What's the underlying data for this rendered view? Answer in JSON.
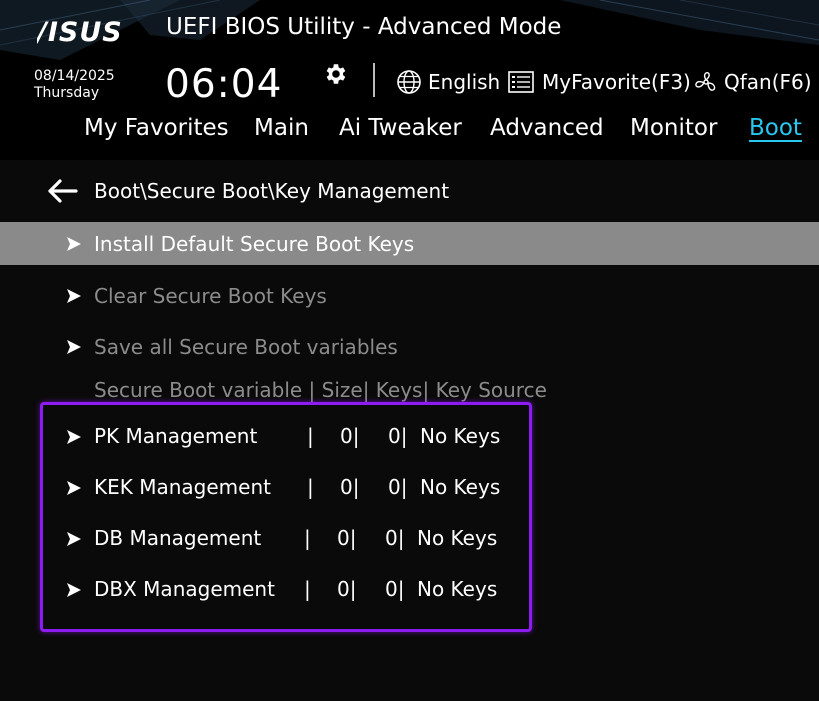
{
  "header": {
    "logo_text": "/ISUS",
    "title": "UEFI BIOS Utility - Advanced Mode",
    "date": "08/14/2025",
    "day": "Thursday",
    "time": "06:04",
    "tools": {
      "language": "English",
      "myfavorite": "MyFavorite(F3)",
      "qfan": "Qfan(F6)"
    }
  },
  "tabs": [
    {
      "label": "My Favorites",
      "active": false
    },
    {
      "label": "Main",
      "active": false
    },
    {
      "label": "Ai Tweaker",
      "active": false
    },
    {
      "label": "Advanced",
      "active": false
    },
    {
      "label": "Monitor",
      "active": false
    },
    {
      "label": "Boot",
      "active": true
    }
  ],
  "breadcrumb": "Boot\\Secure Boot\\Key Management",
  "menu": [
    {
      "label": "Install Default Secure Boot Keys",
      "state": "selected"
    },
    {
      "label": "Clear Secure Boot Keys",
      "state": "disabled"
    },
    {
      "label": "Save all Secure Boot variables",
      "state": "disabled"
    }
  ],
  "key_table": {
    "header": "Secure Boot variable | Size| Keys| Key Source",
    "rows": [
      {
        "name": "PK Management",
        "size": "0",
        "keys": "0",
        "source": "No Keys"
      },
      {
        "name": "KEK Management",
        "size": "0",
        "keys": "0",
        "source": "No Keys"
      },
      {
        "name": "DB Management",
        "size": "0",
        "keys": "0",
        "source": "No Keys"
      },
      {
        "name": "DBX Management",
        "size": "0",
        "keys": "0",
        "source": "No Keys"
      }
    ]
  },
  "colors": {
    "accent": "#29c6f0",
    "highlight_border": "#8d1cf2",
    "selected_row": "#8a8a8a",
    "disabled_text": "#8c8c8c"
  },
  "icons": [
    "asus-logo",
    "gear-icon",
    "globe-icon",
    "favorite-list-icon",
    "fan-icon",
    "back-arrow-icon",
    "chevron-right-icon"
  ]
}
